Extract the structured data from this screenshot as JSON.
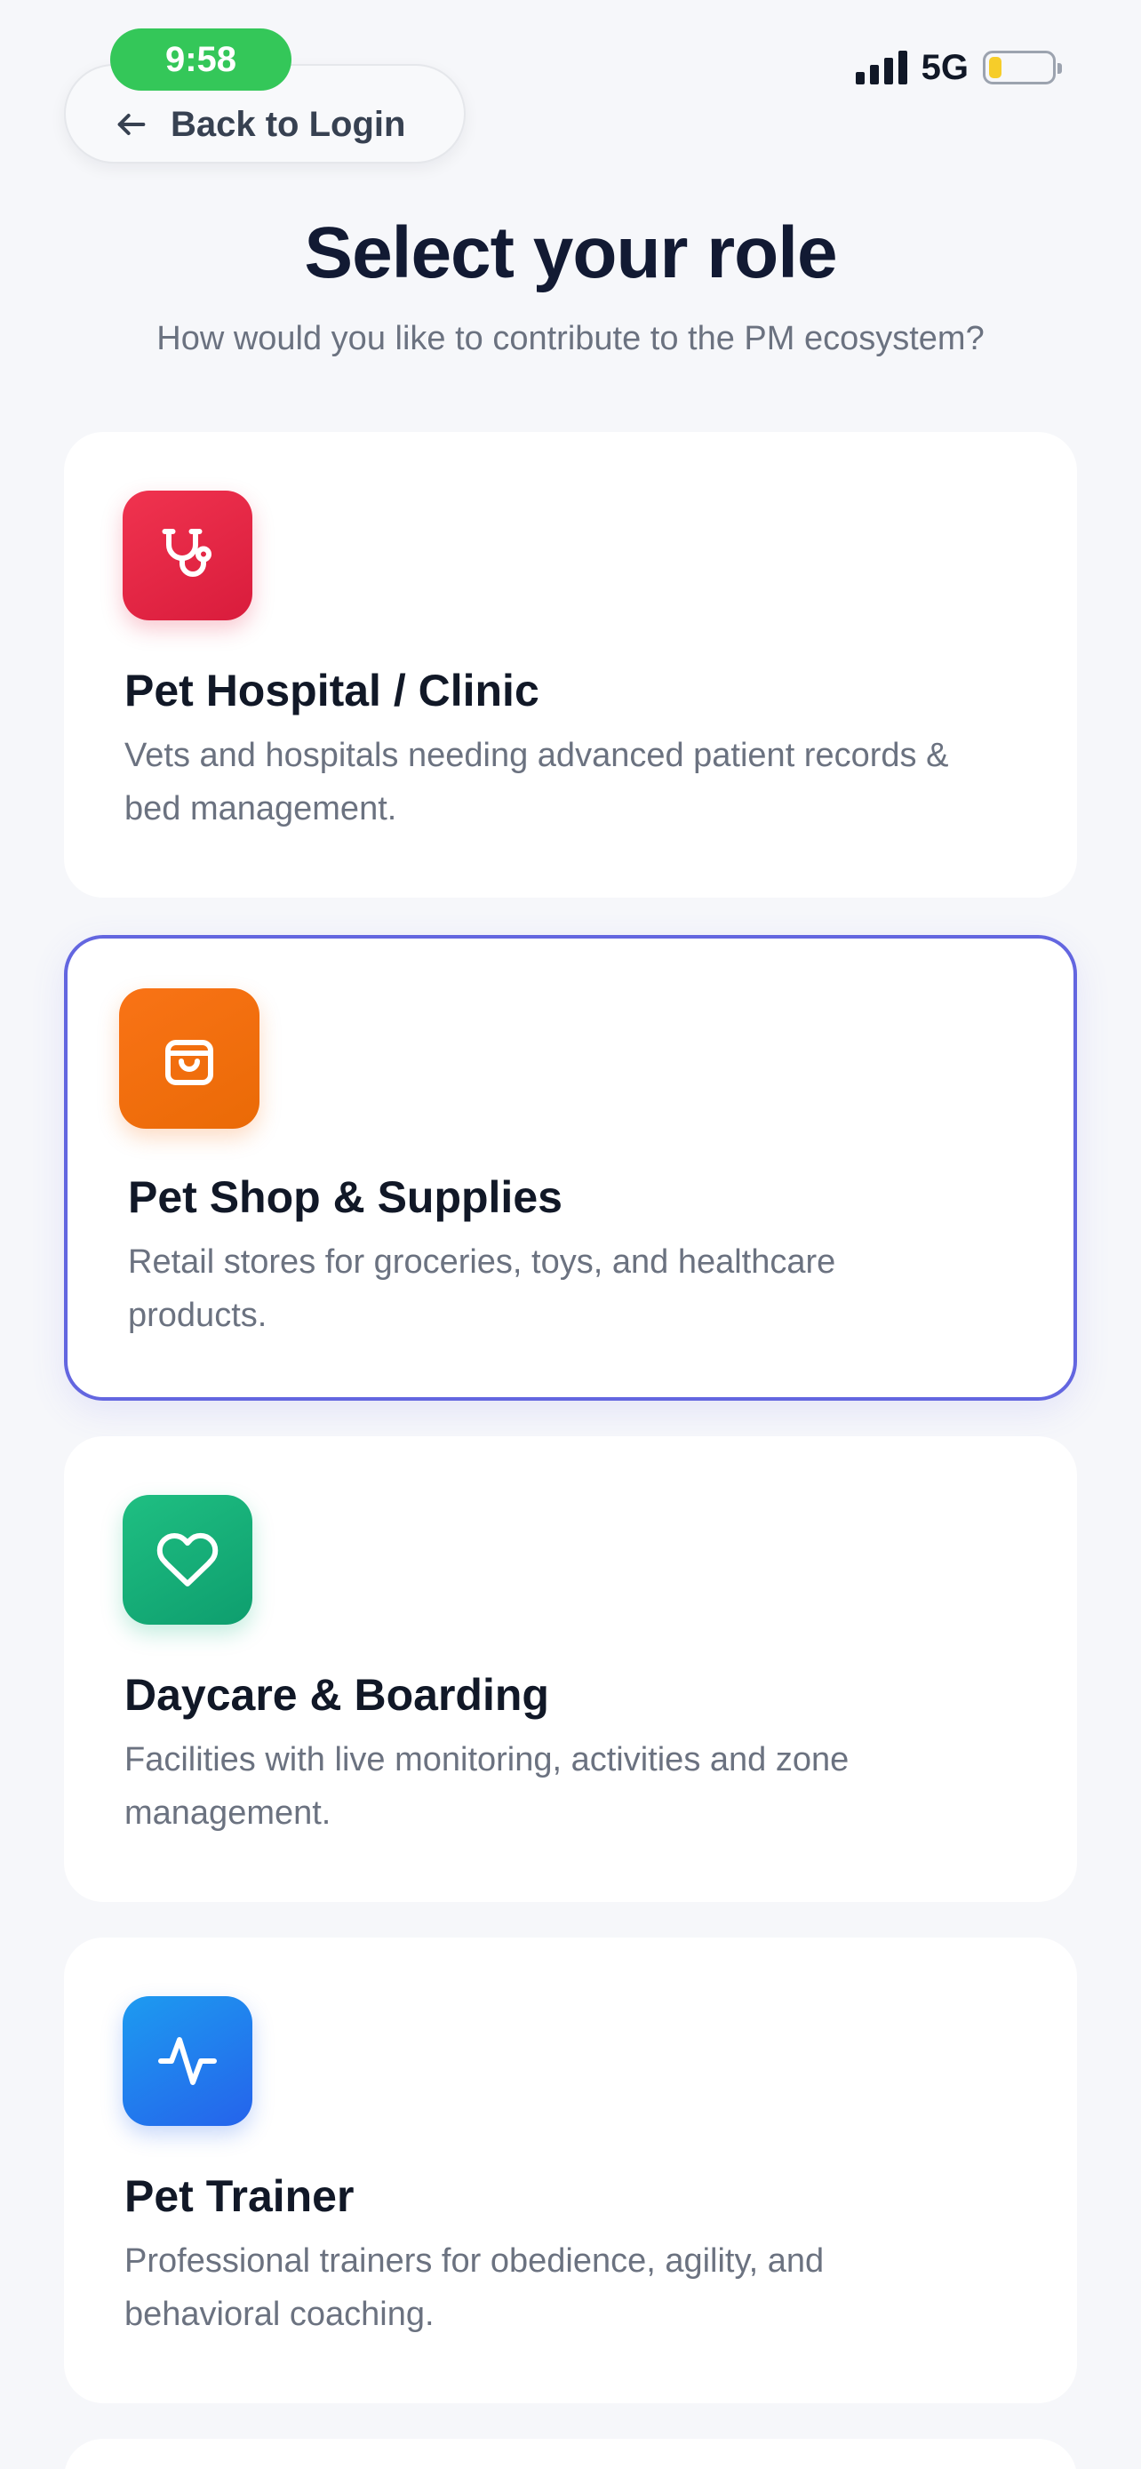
{
  "status_bar": {
    "time": "9:58",
    "network": "5G",
    "battery_level": 0.2,
    "battery_color": "#f6cd2a",
    "time_pill_color": "#34c759"
  },
  "header": {
    "back_label": "Back to Login",
    "back_icon": "arrow-left-icon",
    "title": "Select your role",
    "subtitle": "How would you like to contribute to the PM ecosystem?"
  },
  "roles": [
    {
      "title": "Pet Hospital / Clinic",
      "description": "Vets and hospitals needing advanced patient records & bed management.",
      "icon": "stethoscope-icon",
      "color": "#e8263f",
      "selected": false
    },
    {
      "title": "Pet Shop & Supplies",
      "description": "Retail stores for groceries, toys, and healthcare products.",
      "icon": "shopping-bag-icon",
      "color": "#f97316",
      "selected": true
    },
    {
      "title": "Daycare & Boarding",
      "description": "Facilities with live monitoring, activities and zone management.",
      "icon": "heart-icon",
      "color": "#10b981",
      "selected": false
    },
    {
      "title": "Pet Trainer",
      "description": "Professional trainers for obedience, agility, and behavioral coaching.",
      "icon": "activity-pulse-icon",
      "color": "#2563eb",
      "selected": false
    }
  ],
  "theme": {
    "selected_border": "#6366e0",
    "background": "#f6f7fa"
  }
}
